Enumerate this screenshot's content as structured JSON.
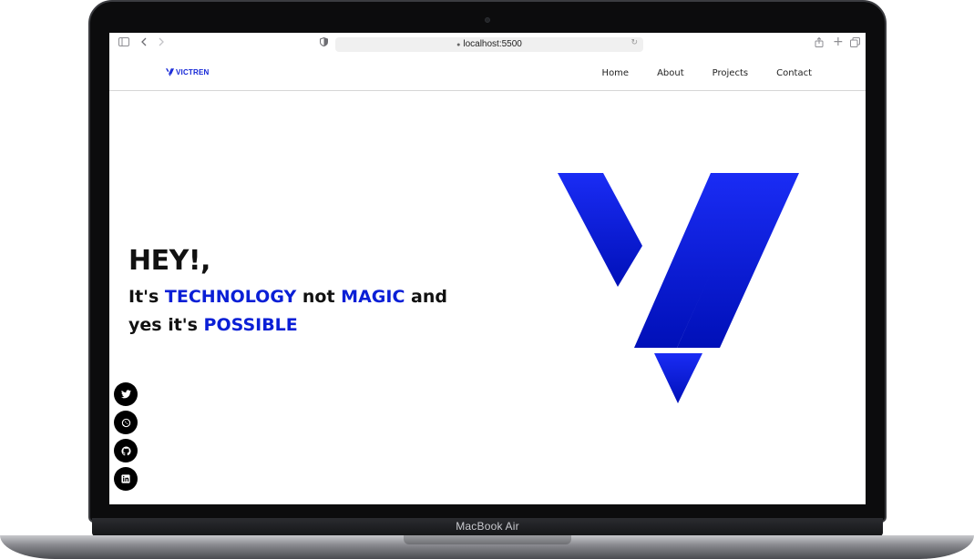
{
  "device": {
    "model_label": "MacBook Air"
  },
  "browser": {
    "url": "localhost:5500",
    "icons": [
      "sidebar-icon",
      "back-icon",
      "forward-icon",
      "privacy-shield-icon",
      "lock-icon",
      "reload-icon",
      "share-icon",
      "new-tab-icon",
      "tabs-overview-icon"
    ]
  },
  "site": {
    "brand": "VICTREN",
    "nav": [
      {
        "label": "Home"
      },
      {
        "label": "About"
      },
      {
        "label": "Projects"
      },
      {
        "label": "Contact"
      }
    ],
    "hero": {
      "greeting": "HEY!,",
      "line1": {
        "a": "It's ",
        "b": "TECHNOLOGY",
        "c": " not ",
        "d": "MAGIC",
        "e": " and"
      },
      "line2": {
        "a": "yes it's ",
        "b": "POSSIBLE"
      }
    },
    "social": [
      {
        "name": "twitter-icon"
      },
      {
        "name": "whatsapp-icon"
      },
      {
        "name": "github-icon"
      },
      {
        "name": "linkedin-icon"
      }
    ]
  },
  "colors": {
    "accent": "#0a1fd6",
    "logo_top": "#1a2cf5",
    "logo_bottom": "#0010b8"
  }
}
